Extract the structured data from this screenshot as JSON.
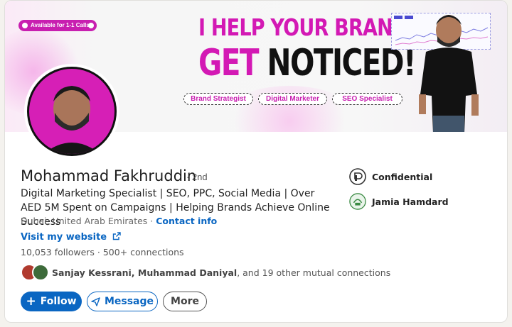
{
  "banner": {
    "availability": "Available for 1-1 Calls",
    "headline_line1": "I HELP YOUR BRAND",
    "headline_get": "GET",
    "headline_noticed": "NOTICED!",
    "chips": [
      "Brand Strategist",
      "Digital Marketer",
      "SEO Specialist"
    ]
  },
  "profile": {
    "name": "Mohammad Fakhruddin",
    "degree": "· 2nd",
    "headline": "Digital Marketing Specialist | SEO, PPC, Social Media | Over AED 5M Spent on Campaigns | Helping Brands Achieve Online Success",
    "location": "Dubai, United Arab Emirates",
    "location_sep": " · ",
    "contact_info": "Contact info",
    "website": "Visit my website",
    "followers": "10,053 followers",
    "connections": "500+ connections",
    "mutual_names": "Sanjay Kessrani, Muhammad Daniyal",
    "mutual_rest": ", and 19 other mutual connections"
  },
  "sidebar": {
    "company": "Confidential",
    "school": "Jamia Hamdard"
  },
  "actions": {
    "follow": "Follow",
    "message": "Message",
    "more": "More"
  },
  "colors": {
    "accent": "#0a66c2",
    "brand_pink": "#d319b4"
  }
}
